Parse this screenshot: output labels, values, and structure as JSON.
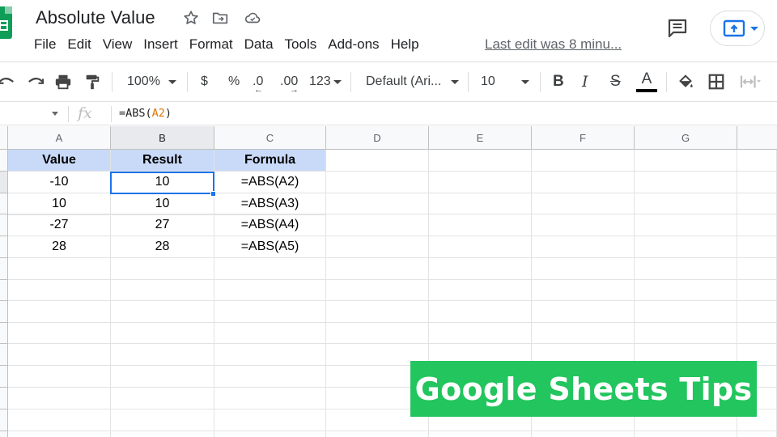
{
  "app": {
    "title": "Absolute Value",
    "last_edit": "Last edit was 8 minu...",
    "menu": [
      "File",
      "Edit",
      "View",
      "Insert",
      "Format",
      "Data",
      "Tools",
      "Add-ons",
      "Help"
    ]
  },
  "toolbar": {
    "zoom": "100%",
    "currency": "$",
    "percent": "%",
    "decimal_decrease": ".0",
    "decimal_increase": ".00",
    "number_format": "123",
    "font": "Default (Ari...",
    "font_size": "10",
    "bold": "B",
    "italic": "I",
    "strike": "S",
    "text_color": "A",
    "text_color_value": "#000000"
  },
  "formula_bar": {
    "fx": "fx",
    "formula_prefix": "=ABS(",
    "formula_ref": "A2",
    "formula_suffix": ")"
  },
  "sheet": {
    "columns": [
      "A",
      "B",
      "C",
      "D",
      "E",
      "F",
      "G"
    ],
    "header_row": [
      "Value",
      "Result",
      "Formula"
    ],
    "rows": [
      [
        "-10",
        "10",
        "=ABS(A2)"
      ],
      [
        "10",
        "10",
        "=ABS(A3)"
      ],
      [
        "-27",
        "27",
        "=ABS(A4)"
      ],
      [
        "28",
        "28",
        "=ABS(A5)"
      ]
    ],
    "selected_cell": "B2",
    "header_fill": "#c9daf8"
  },
  "banner": {
    "text": "Google Sheets Tips",
    "color": "#22c55e"
  },
  "colors": {
    "accent": "#1a73e8",
    "sheets_green": "#0f9d58"
  }
}
